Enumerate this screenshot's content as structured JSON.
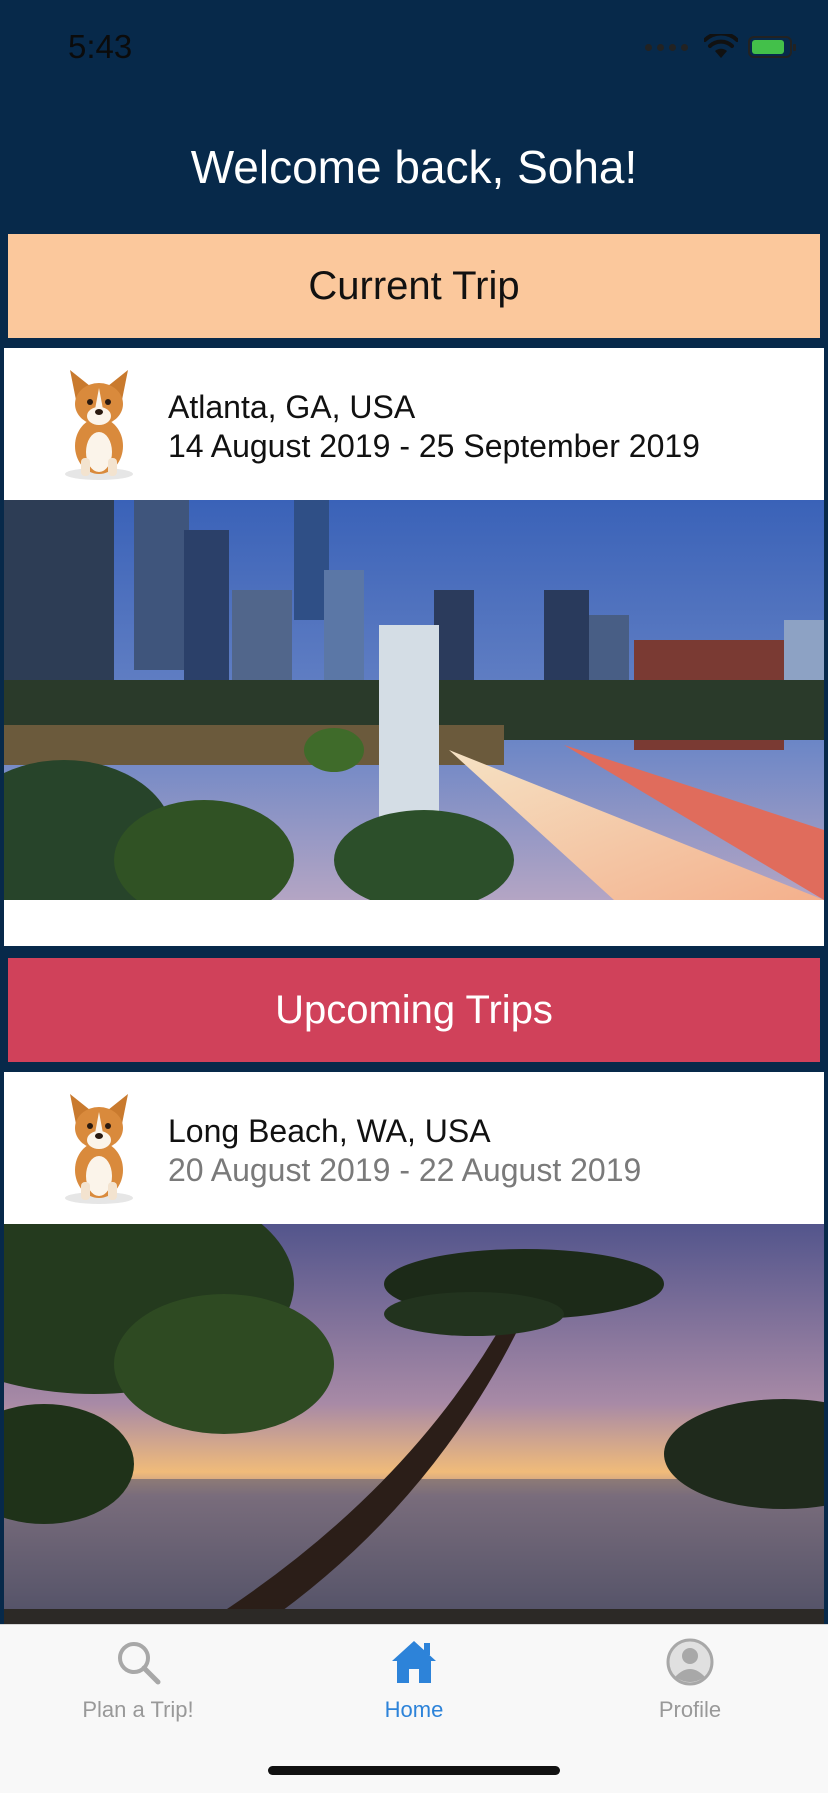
{
  "status": {
    "time": "5:43"
  },
  "welcome": "Welcome back, Soha!",
  "current_trip": {
    "header": "Current Trip",
    "location": "Atlanta, GA, USA",
    "dates": "14 August 2019 - 25 September 2019"
  },
  "upcoming_trips": {
    "header": "Upcoming Trips",
    "items": [
      {
        "location": "Long Beach, WA, USA",
        "dates": "20 August 2019 - 22 August 2019"
      }
    ]
  },
  "tabs": [
    {
      "label": "Plan a Trip!",
      "icon": "search-icon"
    },
    {
      "label": "Home",
      "icon": "home-icon",
      "active": true
    },
    {
      "label": "Profile",
      "icon": "profile-icon"
    }
  ],
  "colors": {
    "background": "#07294a",
    "current_header": "#fbc89c",
    "upcoming_header": "#d0415a",
    "tab_active": "#2d83d9",
    "tab_inactive": "#999999"
  }
}
